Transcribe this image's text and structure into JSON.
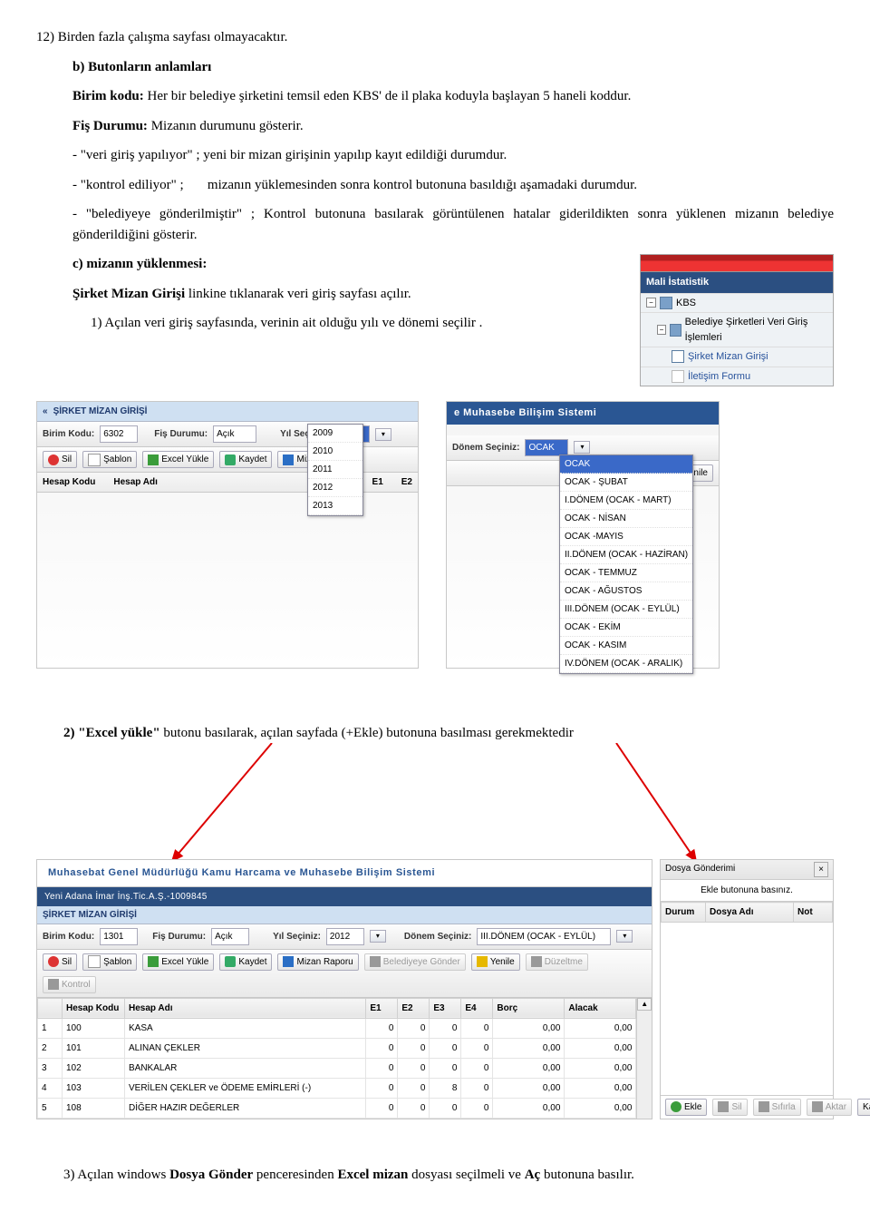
{
  "p12": "12) Birden fazla çalışma sayfası olmayacaktır.",
  "h_b": "b) Butonların anlamları",
  "p_birimkodu_lbl": "Birim kodu:",
  "p_birimkodu_txt": " Her bir belediye şirketini temsil eden KBS' de il plaka koduyla başlayan 5 haneli koddur.",
  "p_fis_lbl": "Fiş Durumu:",
  "p_fis_txt": " Mizanın durumunu gösterir.",
  "p_veri": "- \"veri giriş yapılıyor\" ;  yeni bir mizan girişinin yapılıp kayıt edildiği durumdur.",
  "p_kontrol_a": "- \"kontrol ediliyor\" ;",
  "p_kontrol_b": "mizanın yüklemesinden sonra kontrol butonuna basıldığı aşamadaki durumdur.",
  "p_belediye": "- \"belediyeye gönderilmiştir\" ; Kontrol butonuna basılarak görüntülenen hatalar giderildikten sonra yüklenen mizanın belediye gönderildiğini gösterir.",
  "h_c": "c) mizanın yüklenmesi:",
  "p_link_a": "Şirket Mizan Girişi",
  "p_link_b": " linkine tıklanarak veri giriş sayfası açılır.",
  "p_step1": "1) Açılan veri giriş sayfasında, verinin ait olduğu yılı ve dönemi seçilir .",
  "nav": {
    "title": "Mali İstatistik",
    "root": "KBS",
    "group": "Belediye Şirketleri Veri Giriş İşlemleri",
    "item1": "Şirket Mizan Girişi",
    "item2": "İletişim Formu"
  },
  "panel1": {
    "title": "ŞİRKET MİZAN GİRİŞİ",
    "scroll": "«",
    "lbl_bk": "Birim Kodu:",
    "val_bk": "6302",
    "lbl_fd": "Fiş Durumu:",
    "val_fd": "Açık",
    "lbl_yil": "Yıl Seçiniz:",
    "val_yil": "2013",
    "btn_sil": "Sil",
    "btn_sablon": "Şablon",
    "btn_excel": "Excel Yükle",
    "btn_kaydet": "Kaydet",
    "btn_rapor": "Mizan Raporu",
    "col1": "Hesap Kodu",
    "col2": "Hesap Adı",
    "col3": "E1",
    "col4": "E2",
    "years": [
      "2009",
      "2010",
      "2011",
      "2012",
      "2013"
    ]
  },
  "panel2": {
    "bar": "e  Muhasebe  Bilişim  Sistemi",
    "lbl_donem": "Dönem Seçiniz:",
    "val_donem": "OCAK",
    "btn_yenile": "Yenile",
    "periods": [
      "OCAK",
      "OCAK - ŞUBAT",
      "I.DÖNEM (OCAK - MART)",
      "OCAK - NİSAN",
      "OCAK -MAYIS",
      "II.DÖNEM (OCAK - HAZİRAN)",
      "OCAK - TEMMUZ",
      "OCAK - AĞUSTOS",
      "III.DÖNEM (OCAK - EYLÜL)",
      "OCAK - EKİM",
      "OCAK - KASIM",
      "IV.DÖNEM (OCAK - ARALIK)"
    ]
  },
  "step2_a": "2) \"Excel   yükle\"",
  "step2_b": "   butonu   basılarak,   açılan   sayfada   (+Ekle)   butonuna   basılması gerekmektedir",
  "wide": {
    "title": "Muhasebat  Genel  Müdürlüğü  Kamu  Harcama  ve  Muhasebe  Bilişim  Sistemi",
    "crumb": "Yeni  Adana  İmar  İnş.Tic.A.Ş.-1009845",
    "section": "ŞİRKET MİZAN GİRİŞİ",
    "lbl_bk": "Birim Kodu:",
    "val_bk": "1301",
    "lbl_fd": "Fiş Durumu:",
    "val_fd": "Açık",
    "lbl_yil": "Yıl Seçiniz:",
    "val_yil": "2012",
    "lbl_donem": "Dönem Seçiniz:",
    "val_donem": "III.DÖNEM (OCAK - EYLÜL)",
    "btn_sil": "Sil",
    "btn_sablon": "Şablon",
    "btn_excel": "Excel Yükle",
    "btn_kaydet": "Kaydet",
    "btn_rapor": "Mizan Raporu",
    "btn_gonder": "Belediyeye Gönder",
    "btn_yenile": "Yenile",
    "btn_duzeltme": "Düzeltme",
    "btn_kontrol": "Kontrol",
    "cols": [
      "",
      "Hesap Kodu",
      "Hesap Adı",
      "E1",
      "E2",
      "E3",
      "E4",
      "Borç",
      "Alacak"
    ],
    "rows": [
      [
        "1",
        "100",
        "KASA",
        "0",
        "0",
        "0",
        "0",
        "0,00",
        "0,00"
      ],
      [
        "2",
        "101",
        "ALINAN ÇEKLER",
        "0",
        "0",
        "0",
        "0",
        "0,00",
        "0,00"
      ],
      [
        "3",
        "102",
        "BANKALAR",
        "0",
        "0",
        "0",
        "0",
        "0,00",
        "0,00"
      ],
      [
        "4",
        "103",
        "VERİLEN ÇEKLER ve ÖDEME EMİRLERİ (-)",
        "0",
        "0",
        "8",
        "0",
        "0,00",
        "0,00"
      ],
      [
        "5",
        "108",
        "DİĞER HAZIR DEĞERLER",
        "0",
        "0",
        "0",
        "0",
        "0,00",
        "0,00"
      ]
    ]
  },
  "uploader": {
    "title": "Dosya Gönderimi",
    "close": "×",
    "msg": "Ekle butonuna basınız.",
    "col1": "Durum",
    "col2": "Dosya Adı",
    "col3": "Not",
    "btn_ekle": "Ekle",
    "btn_sil": "Sil",
    "btn_sifirla": "Sıfırla",
    "btn_aktar": "Aktar",
    "btn_kapat": "Kapat"
  },
  "step3_a": "3) Açılan windows ",
  "step3_b": "Dosya Gönder",
  "step3_c": " penceresinden ",
  "step3_d": "Excel mizan",
  "step3_e": " dosyası seçilmeli ve ",
  "step3_f": "Aç",
  "step3_g": " butonuna basılır."
}
